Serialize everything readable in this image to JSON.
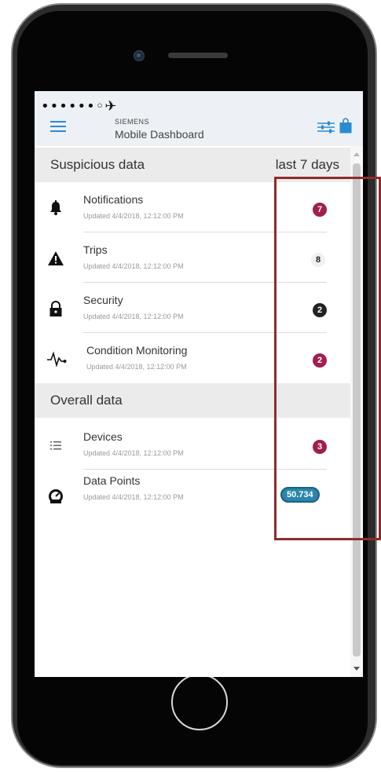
{
  "status_bar": {
    "text": "••••••◦✈"
  },
  "header": {
    "brand": "SIEMENS",
    "title": "Mobile Dashboard"
  },
  "colors": {
    "accent": "#2b8bcf",
    "badge_red": "#a11e4f",
    "badge_dark": "#222222",
    "badge_blue": "#2a86ad",
    "highlight": "#8e2c2a"
  },
  "suspicious": {
    "title": "Suspicious data",
    "range": "last 7 days",
    "items": [
      {
        "label": "Notifications",
        "updated": "Updated 4/4/2018, 12:12:00 PM",
        "badge": "7",
        "icon": "bell-icon"
      },
      {
        "label": "Trips",
        "updated": "Updated 4/4/2018, 12:12:00 PM",
        "badge": "8",
        "icon": "warning-icon"
      },
      {
        "label": "Security",
        "updated": "Updated 4/4/2018, 12:12:00 PM",
        "badge": "2",
        "icon": "lock-icon"
      },
      {
        "label": "Condition Monitoring",
        "updated": "Updated 4/4/2018, 12:12:00 PM",
        "badge": "2",
        "icon": "heartbeat-icon"
      }
    ]
  },
  "overall": {
    "title": "Overall data",
    "items": [
      {
        "label": "Devices",
        "updated": "Updated 4/4/2018, 12:12:00 PM",
        "badge": "3",
        "icon": "list-icon"
      },
      {
        "label": "Data Points",
        "updated": "Updated 4/4/2018, 12:12:00 PM",
        "badge": "50.734",
        "icon": "gauge-icon"
      }
    ]
  }
}
